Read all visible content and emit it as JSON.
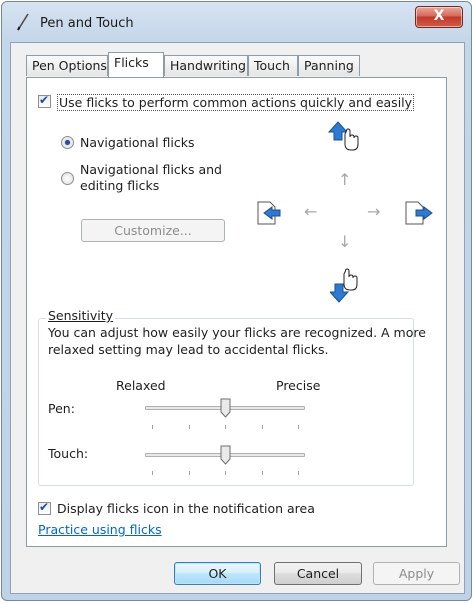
{
  "window": {
    "title": "Pen and Touch",
    "close_label": "X"
  },
  "tabs": [
    {
      "label": "Pen Options"
    },
    {
      "label": "Flicks"
    },
    {
      "label": "Handwriting"
    },
    {
      "label": "Touch"
    },
    {
      "label": "Panning"
    }
  ],
  "flicks": {
    "use_flicks_label": "Use flicks to perform common actions quickly and easily",
    "use_flicks_checked": true,
    "nav_label": "Navigational flicks",
    "nav_edit_label_1": "Navigational flicks and",
    "nav_edit_label_2": "editing flicks",
    "selected_mode": "Navigational flicks",
    "customize_label": "Customize...",
    "arrows": {
      "up": "↑",
      "down": "↓",
      "left": "←",
      "right": "→"
    }
  },
  "sensitivity": {
    "legend": "Sensitivity",
    "description_1": "You can adjust how easily your flicks are recognized. A more",
    "description_2": "relaxed setting may lead to accidental flicks.",
    "relaxed_label": "Relaxed",
    "precise_label": "Precise",
    "pen_label": "Pen:",
    "touch_label": "Touch:",
    "pen_level": 0.5,
    "touch_level": 0.5
  },
  "notification": {
    "display_icon_label": "Display flicks icon in the notification area",
    "display_icon_checked": true
  },
  "practice_link": "Practice using flicks",
  "buttons": {
    "ok": "OK",
    "cancel": "Cancel",
    "apply": "Apply"
  },
  "colors": {
    "accent_blue": "#2e7ad1",
    "link": "#0066cc",
    "close_red": "#c0392b"
  }
}
